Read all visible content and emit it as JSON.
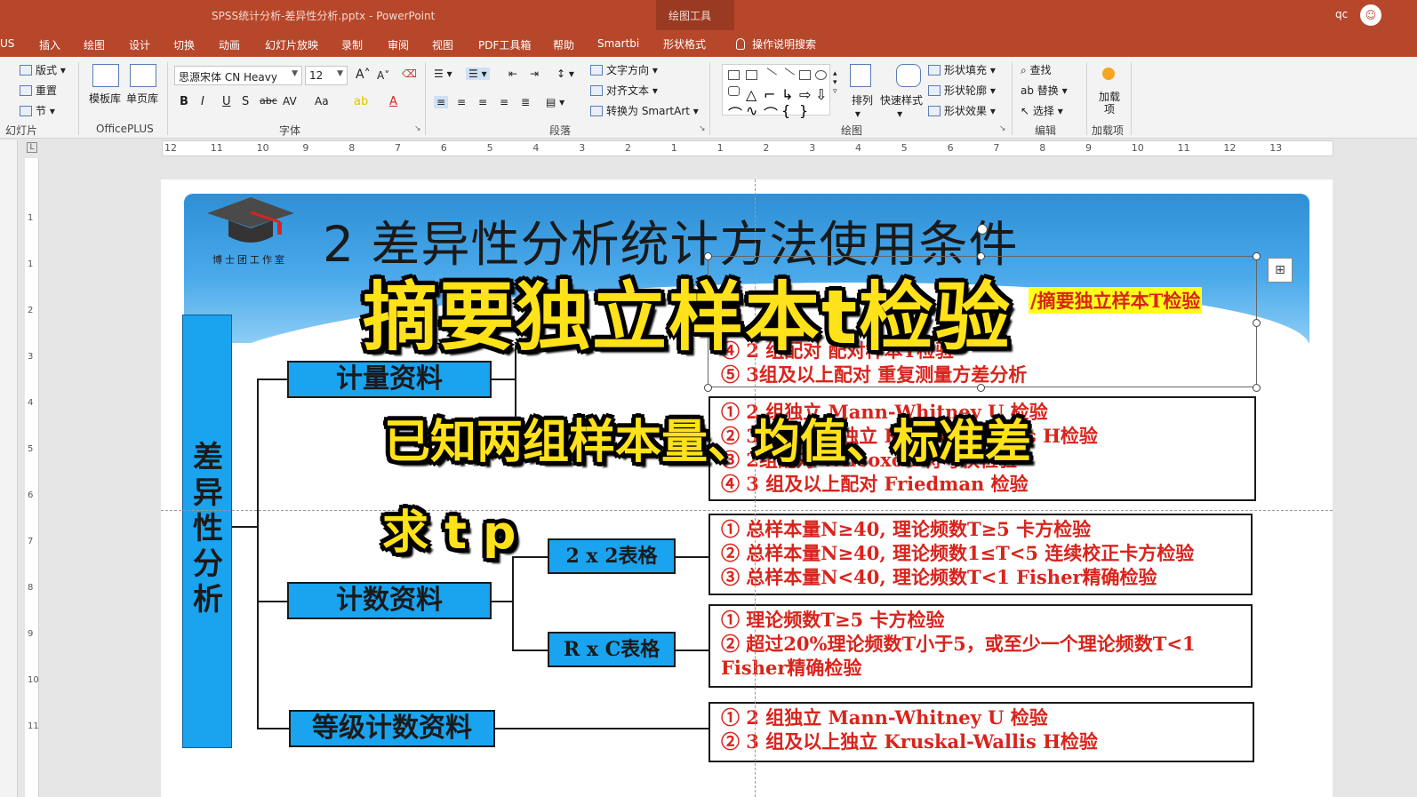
{
  "window": {
    "title": "SPSS统计分析-差异性分析.pptx  -  PowerPoint",
    "context_tool": "绘图工具",
    "user": "qc",
    "avatar_glyph": "☺"
  },
  "tabs": [
    {
      "label": "US"
    },
    {
      "label": "插入"
    },
    {
      "label": "绘图"
    },
    {
      "label": "设计"
    },
    {
      "label": "切换"
    },
    {
      "label": "动画"
    },
    {
      "label": "幻灯片放映"
    },
    {
      "label": "录制"
    },
    {
      "label": "审阅"
    },
    {
      "label": "视图"
    },
    {
      "label": "PDF工具箱"
    },
    {
      "label": "帮助"
    },
    {
      "label": "Smartbi"
    },
    {
      "label": "形状格式"
    }
  ],
  "tell_me": "操作说明搜索",
  "ribbon": {
    "slides": {
      "layout": "版式",
      "reset": "重置",
      "section": "节",
      "group": "幻灯片"
    },
    "officeplus": {
      "template": "模板库",
      "single": "单页库",
      "group": "OfficePLUS"
    },
    "font": {
      "name": "思源宋体 CN Heavy",
      "size": "12",
      "group": "字体",
      "bold": "B",
      "italic": "I",
      "underline": "U",
      "shadow": "S",
      "strike": "abc",
      "spacing": "AV",
      "case": "Aa"
    },
    "paragraph": {
      "text_dir": "文字方向",
      "align_text": "对齐文本",
      "smartart": "转换为 SmartArt",
      "group": "段落"
    },
    "drawing": {
      "arrange": "排列",
      "quick_styles": "快速样式",
      "fill": "形状填充",
      "outline": "形状轮廓",
      "effects": "形状效果",
      "group": "绘图"
    },
    "editing": {
      "find": "查找",
      "replace": "替换",
      "select": "选择",
      "group": "编辑"
    },
    "addins": {
      "add": "加载项",
      "group": "加载项"
    }
  },
  "ruler": {
    "h_marks": [
      "12",
      "11",
      "10",
      "9",
      "8",
      "7",
      "6",
      "5",
      "4",
      "3",
      "2",
      "1",
      "1",
      "2",
      "3",
      "4",
      "5",
      "6",
      "7",
      "8",
      "9",
      "10",
      "11",
      "12",
      "13"
    ],
    "v_marks": [
      "1",
      "1",
      "2",
      "3",
      "4",
      "5",
      "6",
      "7",
      "8",
      "9",
      "10",
      "11"
    ]
  },
  "slide": {
    "title": "2 差异性分析统计方法使用条件",
    "logo_text": "博士团工作室",
    "root_label": [
      "差",
      "异",
      "性",
      "分",
      "析"
    ],
    "cat_measure": "计量资料",
    "cat_count": "计数资料",
    "cat_rank": "等级计数资料",
    "sub_2x2": "2 x 2表格",
    "sub_rxc": "R x C表格",
    "highlight": "/摘要独立样本T检验",
    "box_param": [
      "④  2 组配对              配对样本T检验",
      "⑤  3组及以上配对    重复测量方差分析"
    ],
    "box_nonparam": [
      "①  2 组独立              Mann-Whitney U 检验",
      "②  3 组及以上独立    Kruskal-Wallis H检验",
      "③  2组配对              Wilcoxon 符号秩检验",
      "④  3 组及以上配对    Friedman 检验"
    ],
    "box_2x2": [
      "①  总样本量N≥40,  理论频数T≥5        卡方检验",
      "②  总样本量N≥40,  理论频数1≤T<5    连续校正卡方检验",
      "③  总样本量N<40,  理论频数T<1         Fisher精确检验"
    ],
    "box_rxc": [
      "①  理论频数T≥5         卡方检验",
      "②  超过20%理论频数T小于5，或至少一个理论频数T<1",
      "     Fisher精确检验"
    ],
    "box_rank": [
      "①  2 组独立             Mann-Whitney U 检验",
      "②  3 组及以上独立  Kruskal-Wallis H检验"
    ]
  },
  "overlay": {
    "caption_main": "摘要独立样本t检验",
    "caption_sub": "已知两组样本量、均值、标准差",
    "caption_ask": "求 t p"
  },
  "colors": {
    "brand": "#b7472a",
    "node": "#1aa3ef",
    "method_text": "#d9241c",
    "caption": "#ffe21a"
  }
}
